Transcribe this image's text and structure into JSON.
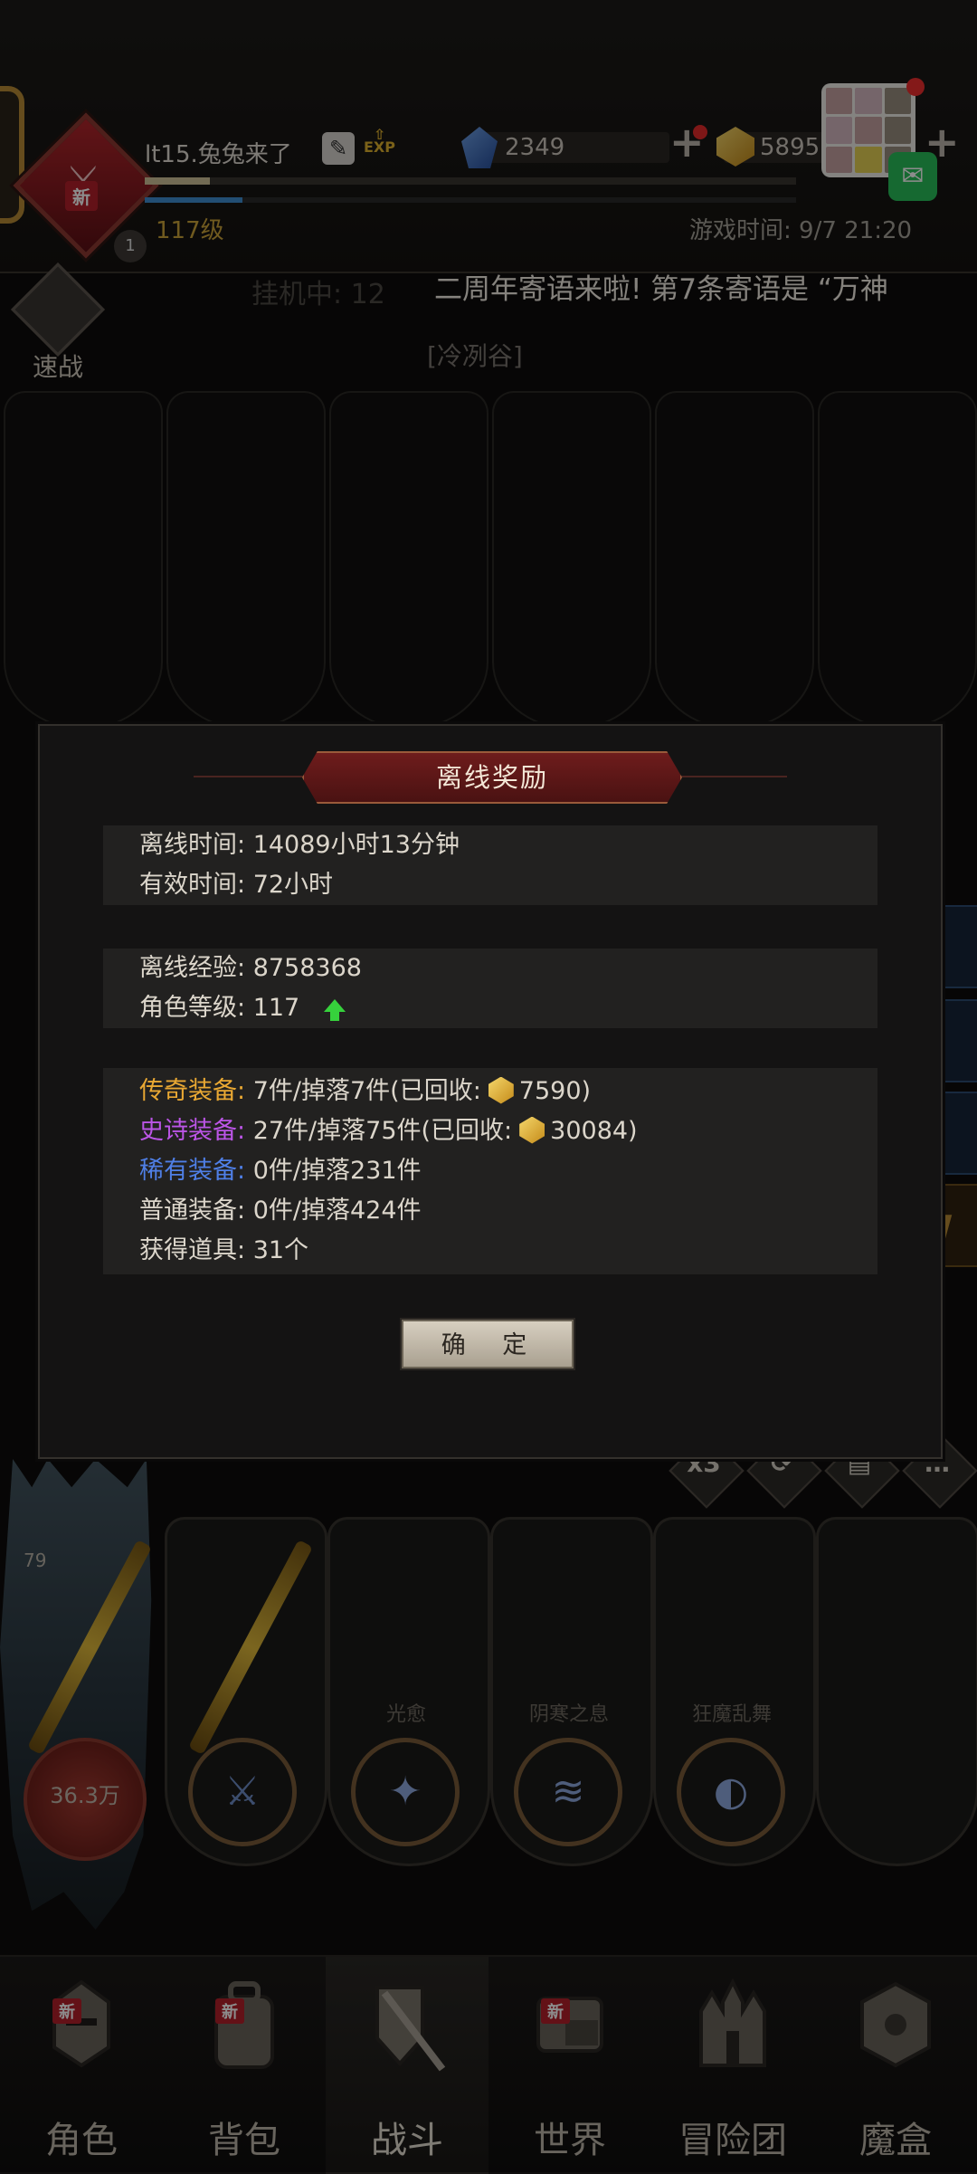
{
  "header": {
    "player_name": "lt15.兔兔来了",
    "avatar_badge": "新",
    "avatar_small_level": "1",
    "exp_label": "EXP",
    "level": "117级",
    "exp_progress": 0.1,
    "hp_progress": 0.15,
    "diamonds": "2349",
    "gold": "5895",
    "game_time": "游戏时间: 9/7 21:20"
  },
  "battle": {
    "quick_battle_label": "速战",
    "idle_status": "挂机中: 12",
    "announcement": "二周年寄语来啦! 第7条寄语是 “万神",
    "zone": "[冷冽谷]"
  },
  "modal": {
    "title": "离线奖励",
    "offline_time_label": "离线时间:",
    "offline_time_value": "14089小时13分钟",
    "effective_time_label": "有效时间:",
    "effective_time_value": "72小时",
    "offline_exp_label": "离线经验:",
    "offline_exp_value": "8758368",
    "char_level_label": "角色等级:",
    "char_level_value": "117",
    "legend_label": "传奇装备:",
    "legend_value": "7件/掉落7件(已回收:",
    "legend_gold": "7590)",
    "epic_label": "史诗装备:",
    "epic_value": "27件/掉落75件(已回收:",
    "epic_gold": "30084)",
    "rare_label": "稀有装备:",
    "rare_value": "0件/掉落231件",
    "normal_label": "普通装备:",
    "normal_value": "0件/掉落424件",
    "items_label": "获得道具:",
    "items_value": "31个",
    "confirm": "确 定"
  },
  "toolbar": {
    "speed": "x3",
    "icons": [
      "x3",
      "speed-icon",
      "scroll-icon",
      "chat-icon"
    ]
  },
  "skills": {
    "hp_value": "36.3万",
    "small_level": "79",
    "names": [
      "光愈",
      "阴寒之息",
      "狂魔乱舞"
    ]
  },
  "nav": {
    "items": [
      {
        "label": "角色",
        "icon": "helmet-icon",
        "new": "新"
      },
      {
        "label": "背包",
        "icon": "backpack-icon",
        "new": "新"
      },
      {
        "label": "战斗",
        "icon": "sword-shield-icon",
        "new": ""
      },
      {
        "label": "世界",
        "icon": "scroll-map-icon",
        "new": "新"
      },
      {
        "label": "冒险团",
        "icon": "castle-icon",
        "new": ""
      },
      {
        "label": "魔盒",
        "icon": "magic-box-icon",
        "new": ""
      }
    ]
  },
  "colors": {
    "legend": "#e9a833",
    "epic": "#bb55e6",
    "rare": "#4f7fe6",
    "accent_red": "#6e1c1c"
  }
}
